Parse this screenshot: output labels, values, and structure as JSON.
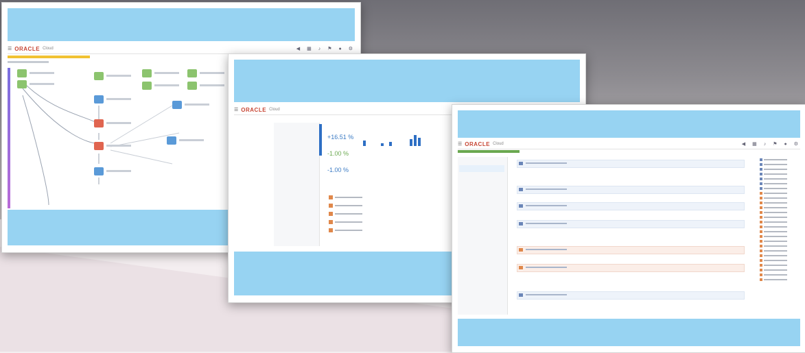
{
  "brand": {
    "logo_text": "ORACLE",
    "accent": "#c74634",
    "banner": "#97d3f2"
  },
  "window1": {
    "app_name": "Cloud"
  },
  "window2": {
    "app_name": "Cloud",
    "metric_1": "+16.51 %",
    "metric_2": "-1.00 %",
    "metric_3": "-1.00 %"
  },
  "window3": {
    "app_name": "Cloud"
  },
  "icons": [
    "back-icon",
    "forward-icon",
    "bell-icon",
    "filter-icon",
    "user-icon",
    "gear-icon",
    "menu-icon"
  ]
}
